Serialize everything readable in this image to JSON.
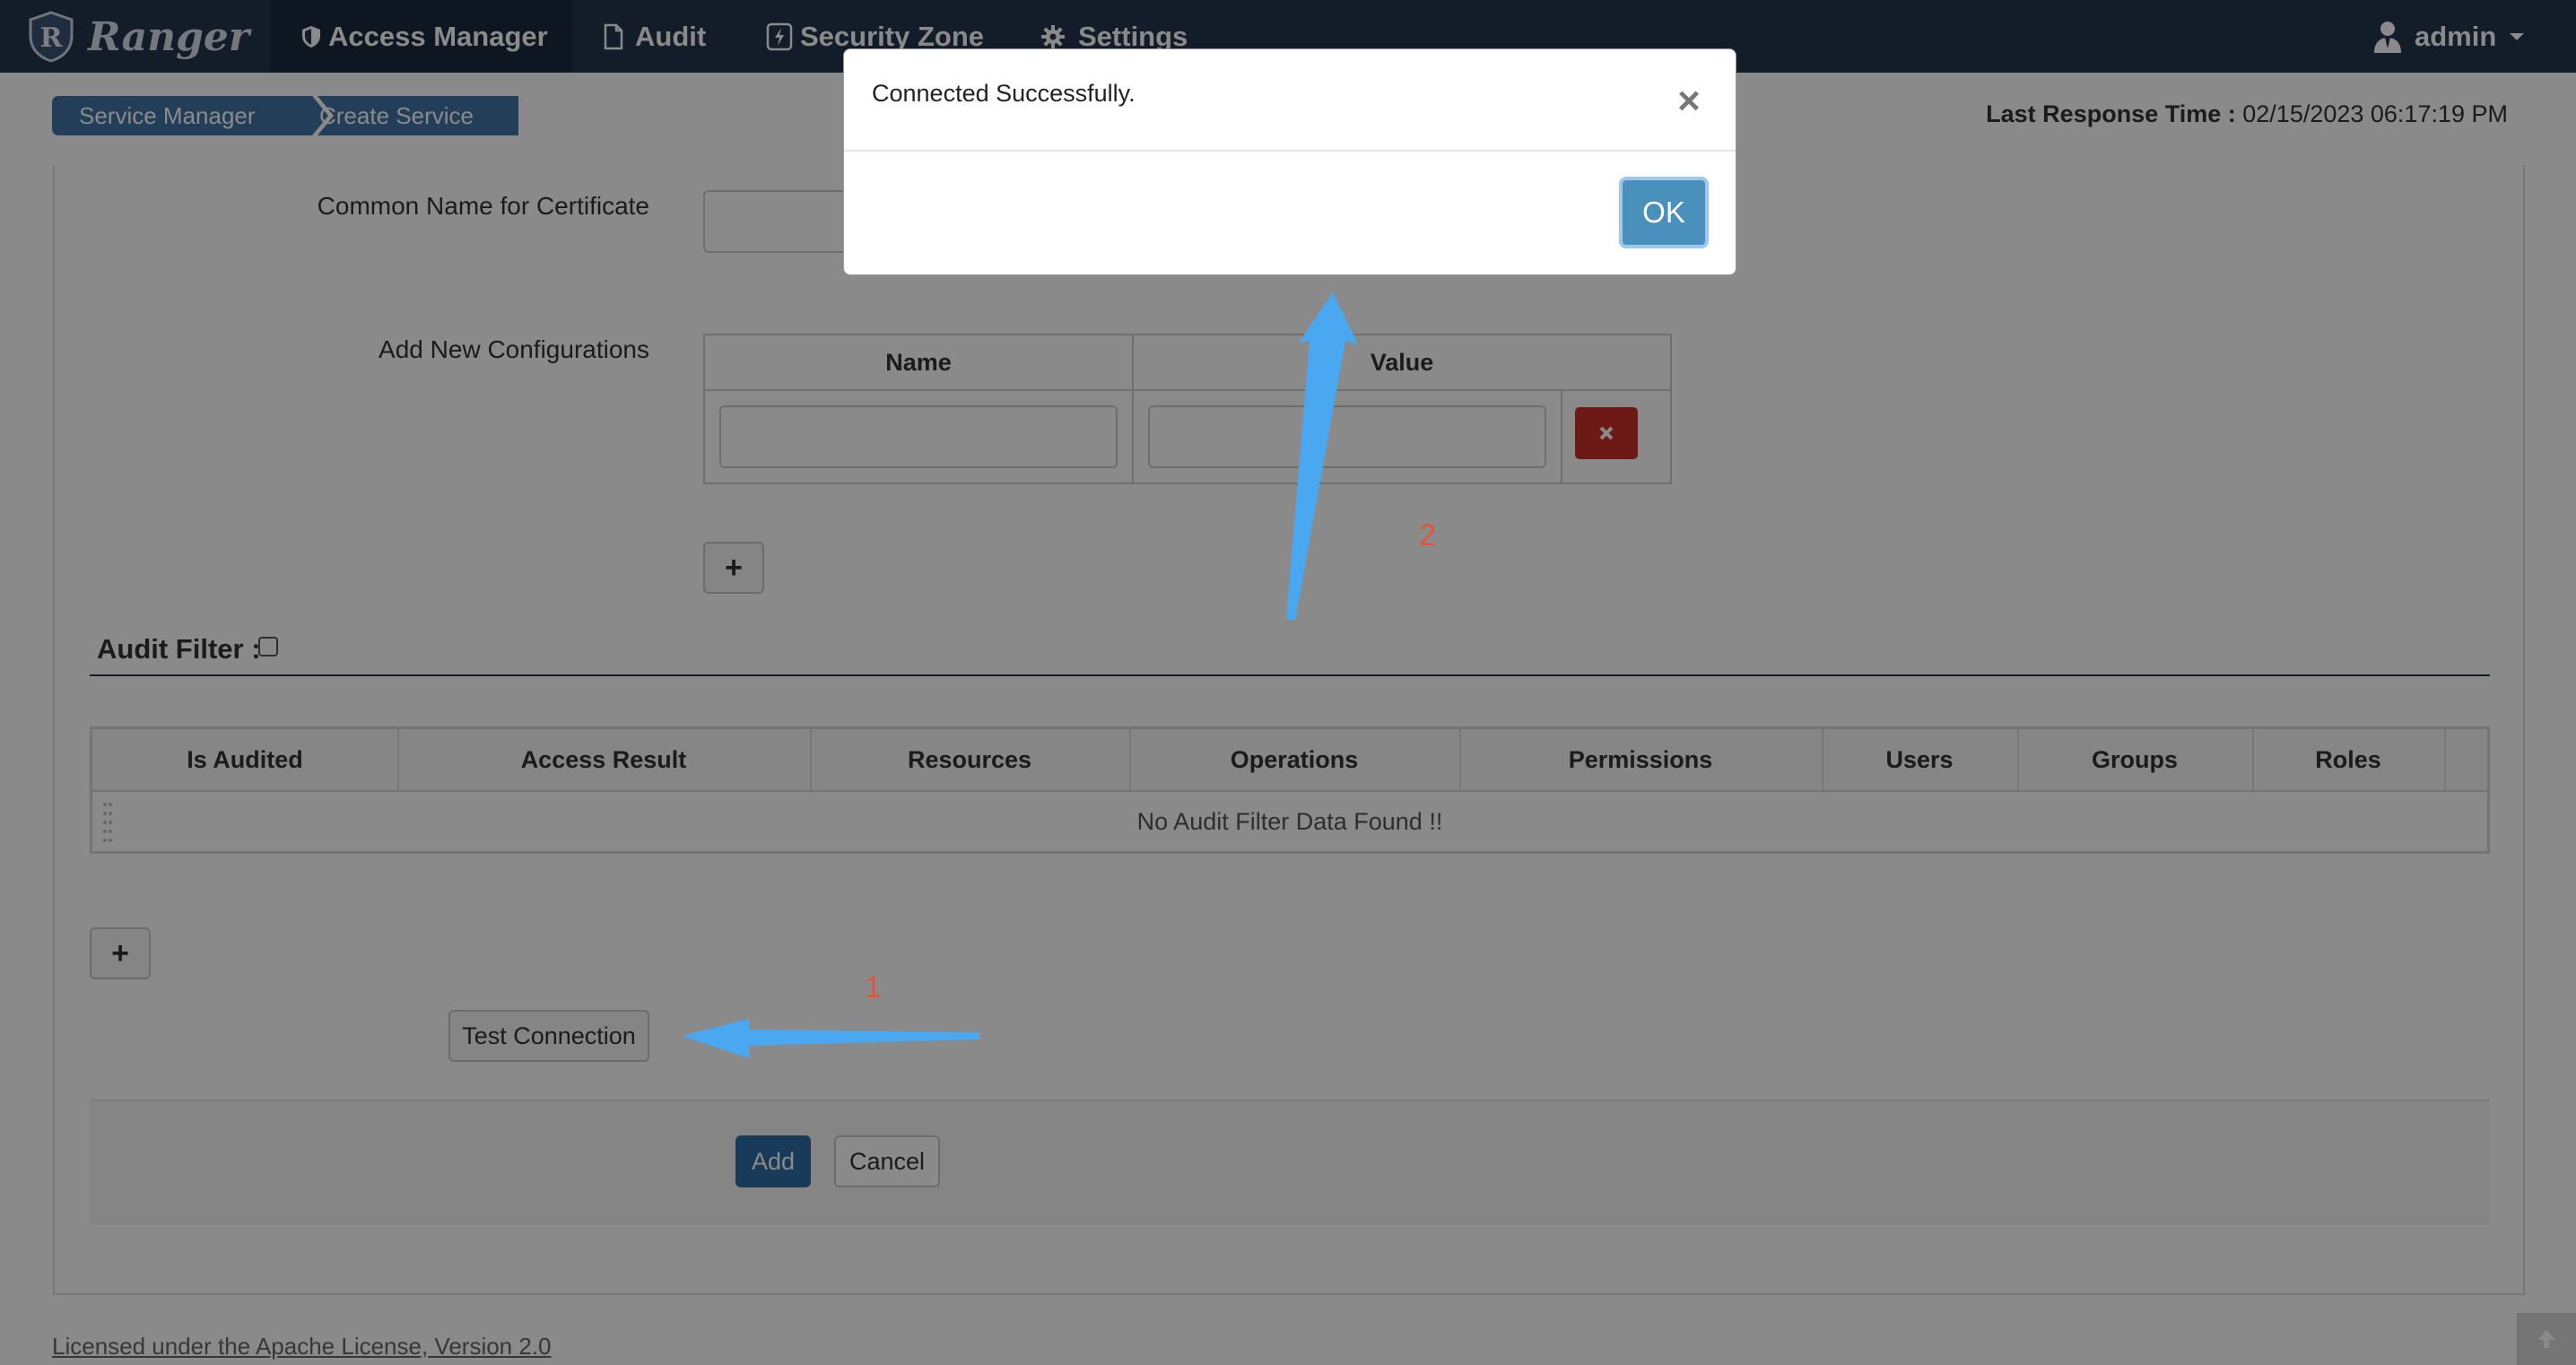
{
  "navbar": {
    "brand": "Ranger",
    "items": [
      {
        "label": "Access Manager",
        "icon": "shield-icon"
      },
      {
        "label": "Audit",
        "icon": "file-icon"
      },
      {
        "label": "Security Zone",
        "icon": "zone-icon"
      },
      {
        "label": "Settings",
        "icon": "gear-icon"
      }
    ],
    "user": {
      "name": "admin",
      "icon": "user-icon"
    }
  },
  "breadcrumb": [
    "Service Manager",
    "Create Service"
  ],
  "last_response": {
    "label": "Last Response Time :",
    "value": "02/15/2023 06:17:19 PM"
  },
  "form": {
    "common_name_label": "Common Name for Certificate",
    "common_name_value": "",
    "add_config_label": "Add New Configurations",
    "config_table": {
      "headers": [
        "Name",
        "Value"
      ],
      "rows": [
        {
          "name": "",
          "value": ""
        }
      ]
    }
  },
  "audit_filter": {
    "title": "Audit Filter :",
    "checked": false,
    "columns": [
      "Is Audited",
      "Access Result",
      "Resources",
      "Operations",
      "Permissions",
      "Users",
      "Groups",
      "Roles"
    ],
    "empty_message": "No Audit Filter Data Found !!"
  },
  "buttons": {
    "test_connection": "Test Connection",
    "add": "Add",
    "cancel": "Cancel"
  },
  "modal": {
    "message": "Connected Successfully.",
    "ok": "OK",
    "close": "×"
  },
  "annotations": {
    "first": "1",
    "second": "2"
  },
  "footer": {
    "license": "Licensed under the Apache License, Version 2.0"
  },
  "colors": {
    "navbar": "#23364f",
    "breadcrumb": "#3f74a5",
    "primary_button": "#2e6da4",
    "danger_button": "#c9302c",
    "arrow": "#4aa8f0",
    "annotation": "#e8523a"
  }
}
